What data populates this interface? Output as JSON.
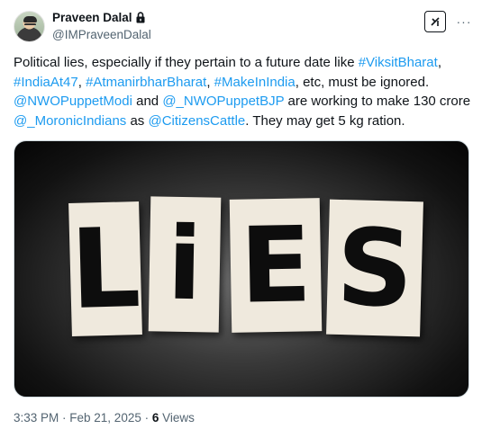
{
  "author": {
    "display_name": "Praveen Dalal",
    "handle": "@IMPraveenDalal",
    "protected_icon": "lock-icon",
    "avatar": "avatar"
  },
  "actions": {
    "grok_icon": "grok-icon",
    "more_icon": "more-icon",
    "more_label": "···"
  },
  "tweet": {
    "segments": [
      {
        "type": "text",
        "value": "Political lies, especially if they pertain to a future date like "
      },
      {
        "type": "link",
        "value": "#ViksitBharat"
      },
      {
        "type": "text",
        "value": ", "
      },
      {
        "type": "link",
        "value": "#IndiaAt47"
      },
      {
        "type": "text",
        "value": ", "
      },
      {
        "type": "link",
        "value": "#AtmanirbharBharat"
      },
      {
        "type": "text",
        "value": ", "
      },
      {
        "type": "link",
        "value": "#MakeInIndia"
      },
      {
        "type": "text",
        "value": ", etc, must be ignored. "
      },
      {
        "type": "link",
        "value": "@NWOPuppetModi"
      },
      {
        "type": "text",
        "value": " and "
      },
      {
        "type": "link",
        "value": "@_NWOPuppetBJP"
      },
      {
        "type": "text",
        "value": " are working to make 130 crore "
      },
      {
        "type": "link",
        "value": "@_MoronicIndians"
      },
      {
        "type": "text",
        "value": " as "
      },
      {
        "type": "link",
        "value": "@CitizensCattle"
      },
      {
        "type": "text",
        "value": ". They may get 5 kg ration."
      }
    ]
  },
  "media": {
    "letters": [
      "L",
      "i",
      "E",
      "S"
    ]
  },
  "meta": {
    "time": "3:33 PM",
    "separator": " · ",
    "date": "Feb 21, 2025",
    "separator2": " · ",
    "views_count": "6",
    "views_label": " Views"
  }
}
